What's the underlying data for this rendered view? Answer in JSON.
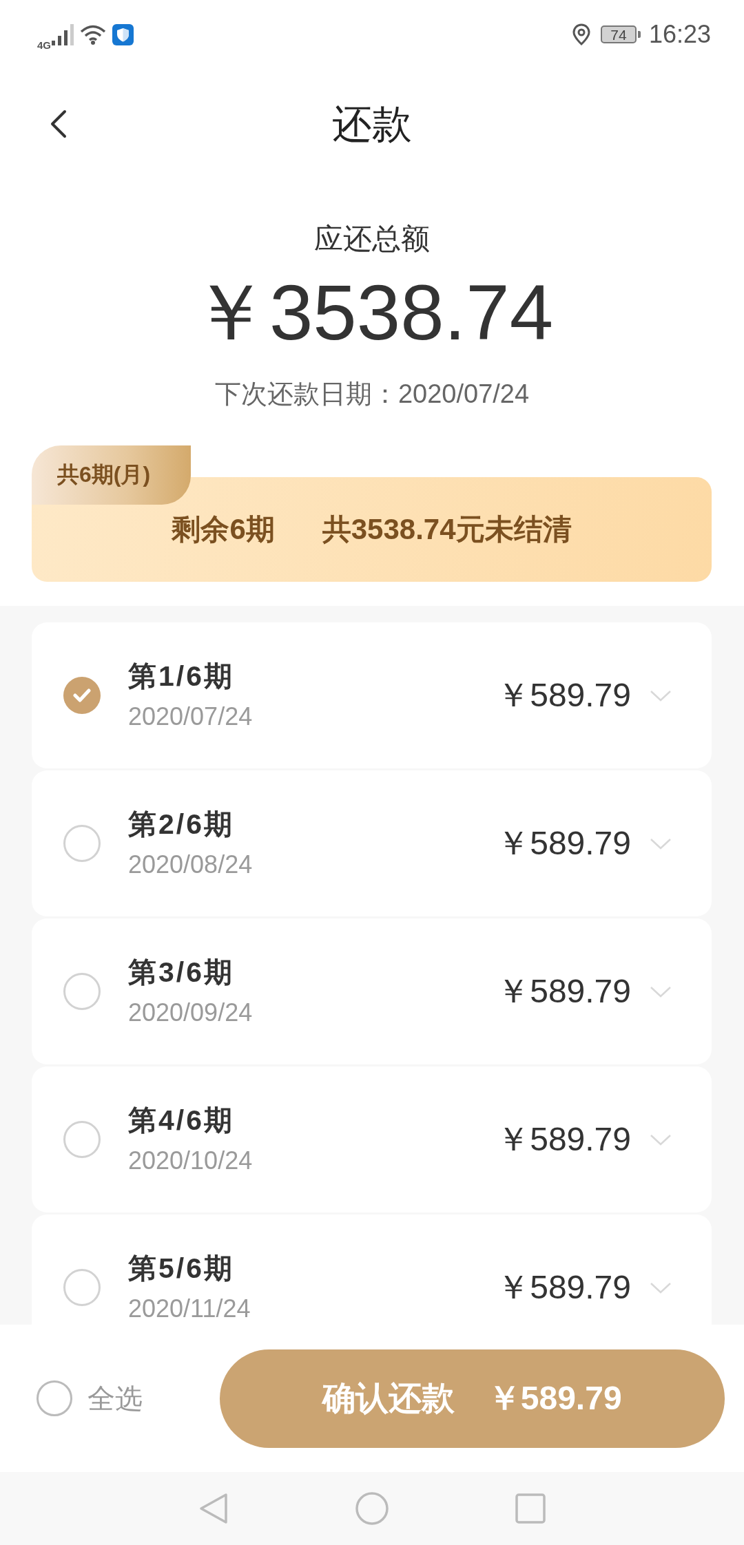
{
  "status_bar": {
    "network": "4G",
    "battery": "74",
    "time": "16:23"
  },
  "header": {
    "title": "还款"
  },
  "summary": {
    "label": "应还总额",
    "amount": "￥3538.74",
    "next_due": "下次还款日期：2020/07/24"
  },
  "plan": {
    "tag": "共6期(月)",
    "remaining": "剩余6期",
    "outstanding": "共3538.74元未结清"
  },
  "installments": [
    {
      "title": "第1/6期",
      "date": "2020/07/24",
      "amount": "￥589.79",
      "selected": true
    },
    {
      "title": "第2/6期",
      "date": "2020/08/24",
      "amount": "￥589.79",
      "selected": false
    },
    {
      "title": "第3/6期",
      "date": "2020/09/24",
      "amount": "￥589.79",
      "selected": false
    },
    {
      "title": "第4/6期",
      "date": "2020/10/24",
      "amount": "￥589.79",
      "selected": false
    },
    {
      "title": "第5/6期",
      "date": "2020/11/24",
      "amount": "￥589.79",
      "selected": false
    }
  ],
  "footer": {
    "select_all": {
      "label": "全选",
      "checked": false
    },
    "confirm": {
      "label": "确认还款",
      "amount": "￥589.79"
    }
  }
}
